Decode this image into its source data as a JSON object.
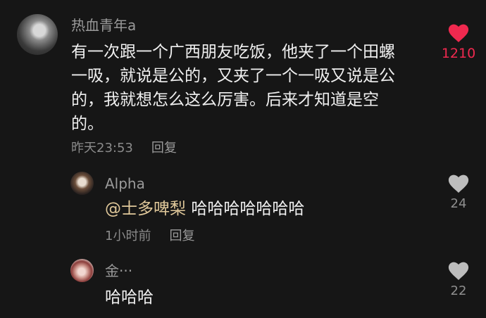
{
  "colors": {
    "background": "#161616",
    "liked_heart": "#f0294f",
    "unliked_heart": "#bdbdbd",
    "mention": "#e0c89a"
  },
  "comments": [
    {
      "username": "热血青年a",
      "lines": [
        "有一次跟一个广西朋友吃饭，他夹了一个田螺",
        "一吸，就说是公的，又夹了一个一吸又说是公",
        "的，我就想怎么这么厉害。后来才知道是空",
        "的。"
      ],
      "time": "昨天23:53",
      "reply_label": "回复",
      "likes": "1210",
      "liked": true,
      "heart_icon": "heart-filled-icon"
    },
    {
      "username": "Alpha",
      "mention": "@士多啤梨",
      "text": "哈哈哈哈哈哈哈",
      "time": "1小时前",
      "reply_label": "回复",
      "likes": "24",
      "liked": false,
      "heart_icon": "heart-icon"
    },
    {
      "username": "金···",
      "text": "哈哈哈",
      "likes": "22",
      "liked": false,
      "heart_icon": "heart-icon"
    }
  ]
}
